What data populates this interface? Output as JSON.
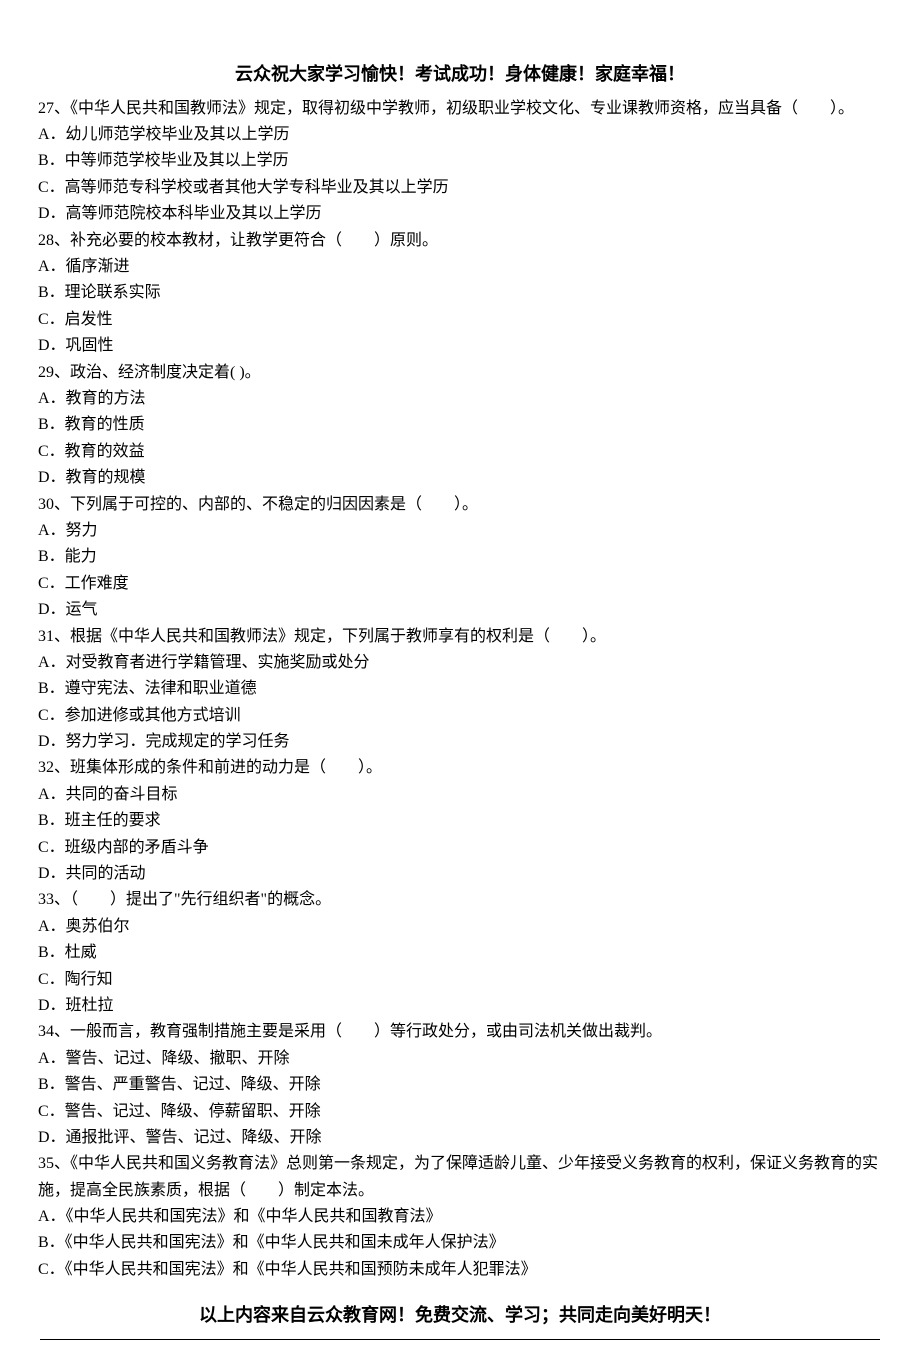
{
  "header": "云众祝大家学习愉快！考试成功！身体健康！家庭幸福！",
  "footer": "以上内容来自云众教育网！免费交流、学习；共同走向美好明天！",
  "lines": [
    "27、《中华人民共和国教师法》规定，取得初级中学教师，初级职业学校文化、专业课教师资格，应当具备（　　）。",
    "A．幼儿师范学校毕业及其以上学历",
    "B．中等师范学校毕业及其以上学历",
    "C．高等师范专科学校或者其他大学专科毕业及其以上学历",
    "D．高等师范院校本科毕业及其以上学历",
    "28、补充必要的校本教材，让教学更符合（　　）原则。",
    "A．循序渐进",
    "B．理论联系实际",
    "C．启发性",
    "D．巩固性",
    "29、政治、经济制度决定着(  )。",
    "A．教育的方法",
    "B．教育的性质",
    "C．教育的效益",
    "D．教育的规模",
    "30、下列属于可控的、内部的、不稳定的归因因素是（　　）。",
    "A．努力",
    "B．能力",
    "C．工作难度",
    "D．运气",
    "31、根据《中华人民共和国教师法》规定，下列属于教师享有的权利是（　　）。",
    "A．对受教育者进行学籍管理、实施奖励或处分",
    "B．遵守宪法、法律和职业道德",
    "C．参加进修或其他方式培训",
    "D．努力学习．完成规定的学习任务",
    "32、班集体形成的条件和前进的动力是（　　）。",
    "A．共同的奋斗目标",
    "B．班主任的要求",
    "C．班级内部的矛盾斗争",
    "D．共同的活动",
    "33、（　　）提出了\"先行组织者\"的概念。",
    "A．奥苏伯尔",
    "B．杜威",
    "C．陶行知",
    "D．班杜拉",
    "34、一般而言，教育强制措施主要是采用（　　）等行政处分，或由司法机关做出裁判。",
    "A．警告、记过、降级、撤职、开除",
    "B．警告、严重警告、记过、降级、开除",
    "C．警告、记过、降级、停薪留职、开除",
    "D．通报批评、警告、记过、降级、开除",
    "35、《中华人民共和国义务教育法》总则第一条规定，为了保障适龄儿童、少年接受义务教育的权利，保证义务教育的实施，提高全民族素质，根据（　　）制定本法。",
    "A．《中华人民共和国宪法》和《中华人民共和国教育法》",
    "B．《中华人民共和国宪法》和《中华人民共和国未成年人保护法》",
    "C．《中华人民共和国宪法》和《中华人民共和国预防未成年人犯罪法》"
  ]
}
